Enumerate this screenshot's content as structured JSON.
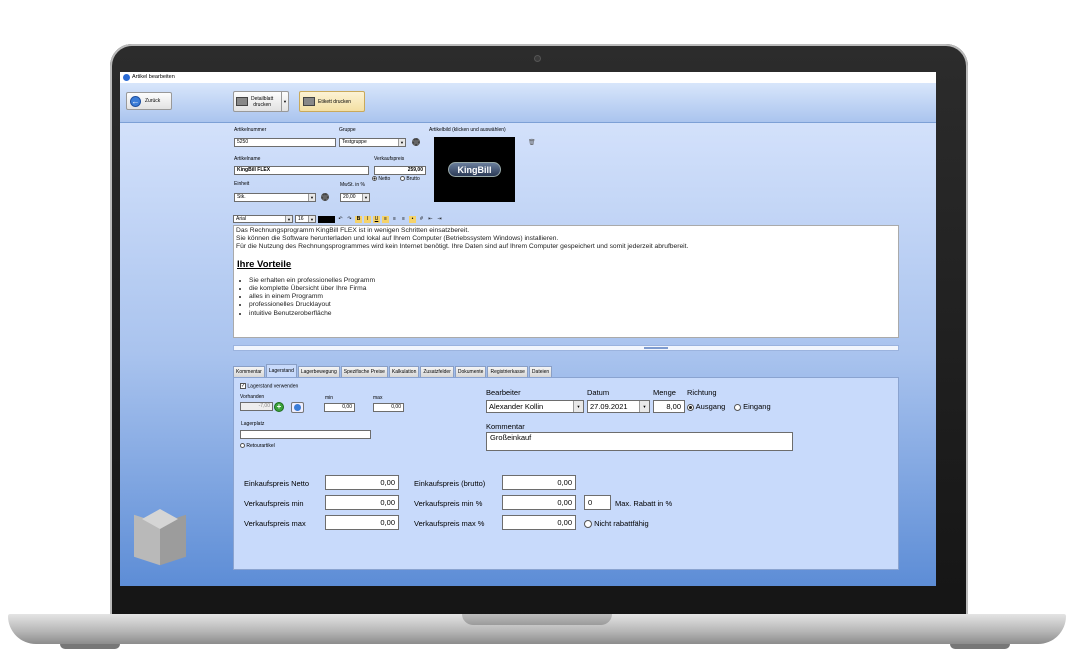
{
  "window": {
    "title": "Artikel bearbeiten"
  },
  "toolbar": {
    "back_label": "Zurück",
    "print_sheet_label_1": "Detailblatt",
    "print_sheet_label_2": "drucken",
    "print_label_label": "Etikett drucken"
  },
  "form": {
    "article_number_label": "Artikelnummer",
    "article_number": "5250",
    "group_label": "Gruppe",
    "group": "Testgruppe",
    "image_label": "Artikelbild (klicken und auswählen)",
    "image_text": "KingBill",
    "name_label": "Artikelname",
    "name": "KingBill FLEX",
    "price_label": "Verkaufspreis",
    "price": "259,00",
    "netto_label": "Netto",
    "brutto_label": "Brutto",
    "unit_label": "Einheit",
    "unit": "Stk.",
    "vat_label": "MwSt. in %",
    "vat": "20,00"
  },
  "editor_toolbar": {
    "font": "Arial",
    "size": "16"
  },
  "description": {
    "line1": "Das Rechnungsprogramm KingBill FLEX ist in wenigen Schritten einsatzbereit.",
    "line2": "Sie können die Software herunterladen und lokal auf Ihrem Computer (Betriebssystem Windows) installieren.",
    "line3": "Für die Nutzung des Rechnungsprogrammes wird kein Internet benötigt. Ihre Daten sind auf Ihrem Computer gespeichert und somit jederzeit abrufbereit.",
    "heading": "Ihre Vorteile",
    "bullets": [
      "Sie erhalten ein professionelles Programm",
      "die komplette Übersicht über Ihre Firma",
      "alles in einem Programm",
      "professionelles Drucklayout",
      "intuitive Benutzeroberfläche"
    ]
  },
  "tabs": [
    "Kommentar",
    "Lagerstand",
    "Lagerbewegung",
    "Spezifische Preise",
    "Kalkulation",
    "Zusatzfelder",
    "Dokumente",
    "Registrierkasse",
    "Dateien"
  ],
  "stock": {
    "use_stock_label": "Lagerstand verwenden",
    "available_label": "Vorhanden",
    "available": "-7,00",
    "min_label": "min",
    "min": "0,00",
    "max_label": "max",
    "max": "0,00",
    "location_label": "Lagerplatz",
    "location": "",
    "return_label": "Retourartikel",
    "editor_label": "Bearbeiter",
    "editor": "Alexander Kollin",
    "date_label": "Datum",
    "date": "27.09.2021",
    "qty_label": "Menge",
    "qty": "8,00",
    "direction_label": "Richtung",
    "out_label": "Ausgang",
    "in_label": "Eingang",
    "comment_label": "Kommentar",
    "comment": "Großeinkauf"
  },
  "pricing": {
    "purchase_net_label": "Einkaufspreis Netto",
    "purchase_net": "0,00",
    "purchase_gross_label": "Einkaufspreis (brutto)",
    "purchase_gross": "0,00",
    "sale_min_label": "Verkaufspreis min",
    "sale_min": "0,00",
    "sale_min_pct_label": "Verkaufspreis min %",
    "sale_min_pct": "0,00",
    "max_discount": "0",
    "max_discount_label": "Max. Rabatt in %",
    "sale_max_label": "Verkaufspreis max",
    "sale_max": "0,00",
    "sale_max_pct_label": "Verkaufspreis max %",
    "sale_max_pct": "0,00",
    "no_discount_label": "Nicht rabattfähig"
  }
}
